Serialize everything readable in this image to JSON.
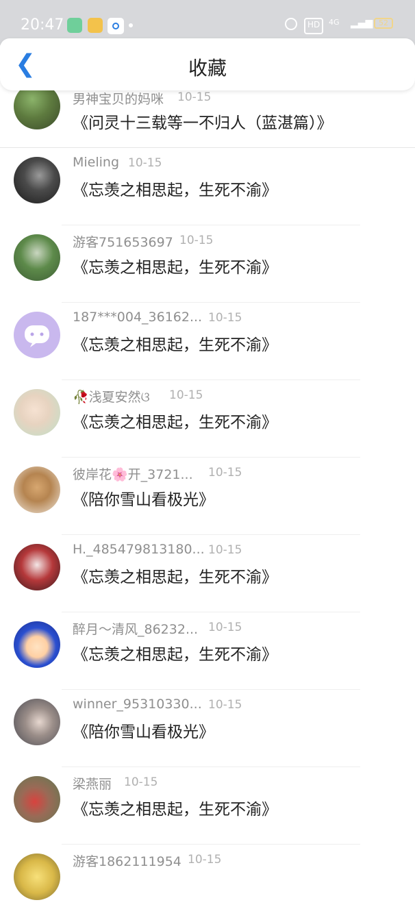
{
  "status_bar": {
    "time": "20:47",
    "hd_label": "HD",
    "network_label": "4G",
    "battery": "52",
    "icons": [
      "app-green-icon",
      "weibo-icon",
      "app-blue-icon",
      "alarm-icon",
      "hd-icon",
      "signal-icon",
      "battery-icon"
    ]
  },
  "header": {
    "title": "收藏",
    "back_icon": "chevron-left-icon"
  },
  "colors": {
    "accent": "#2a7de1",
    "name_text": "#8f8f8f",
    "date_text": "#b0b0b0",
    "main_text": "#222222"
  },
  "items": [
    {
      "name": "男神宝贝的妈咪",
      "date": "10-15",
      "text": "《问灵十三载等一不归人（蓝湛篇）》"
    },
    {
      "name": "Mieling",
      "date": "10-15",
      "text": "《忘羡之相思起，生死不渝》"
    },
    {
      "name": "游客751653697",
      "date": "10-15",
      "text": "《忘羡之相思起，生死不渝》"
    },
    {
      "name": "187***004_36162...",
      "date": "10-15",
      "text": "《忘羡之相思起，生死不渝》"
    },
    {
      "name": "🥀浅夏安然ଓ",
      "date": "10-15",
      "text": "《忘羡之相思起，生死不渝》"
    },
    {
      "name": "彼岸花🌸开_3721...",
      "date": "10-15",
      "text": "《陪你雪山看极光》"
    },
    {
      "name": "H._485479813180...",
      "date": "10-15",
      "text": "《忘羡之相思起，生死不渝》"
    },
    {
      "name": "醉月～清风_86232...",
      "date": "10-15",
      "text": "《忘羡之相思起，生死不渝》"
    },
    {
      "name": "winner_95310330...",
      "date": "10-15",
      "text": "《陪你雪山看极光》"
    },
    {
      "name": "梁燕丽",
      "date": "10-15",
      "text": "《忘羡之相思起，生死不渝》"
    },
    {
      "name": "游客1862111954",
      "date": "10-15",
      "text": ""
    }
  ]
}
